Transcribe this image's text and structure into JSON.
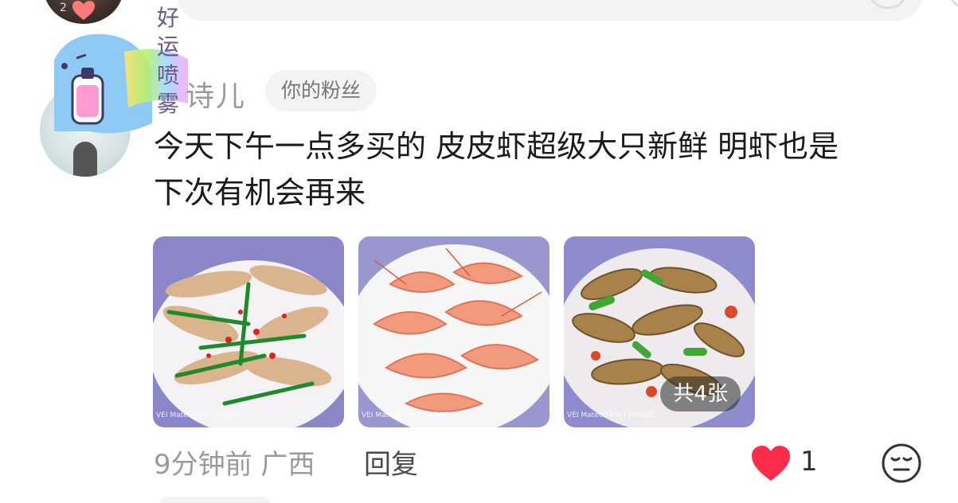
{
  "top_avatar": {
    "badge": "2"
  },
  "sticker": {
    "chars": [
      "好",
      "运",
      "喷",
      "雾"
    ]
  },
  "comment": {
    "username": "诗儿",
    "fan_badge": "你的粉丝",
    "text_line1": "今天下午一点多买的 皮皮虾超级大只新鲜 明虾也是",
    "text_line2": "下次有机会再来",
    "images": [
      {
        "name": "mantis-shrimp-plate",
        "watermark": "VEI Mate60 Pro | XMAGE"
      },
      {
        "name": "boiled-prawns-plate",
        "watermark": "VEI Mate60 Pro | XMAGE"
      },
      {
        "name": "stirfry-clams-plate",
        "watermark": "VEI Mate60 Pro | XMAGE"
      }
    ],
    "image_count": "共4张",
    "time_location": "9分钟前 广西",
    "reply_label": "回复",
    "like_count": "1",
    "like_color": "#ff2d4b"
  }
}
